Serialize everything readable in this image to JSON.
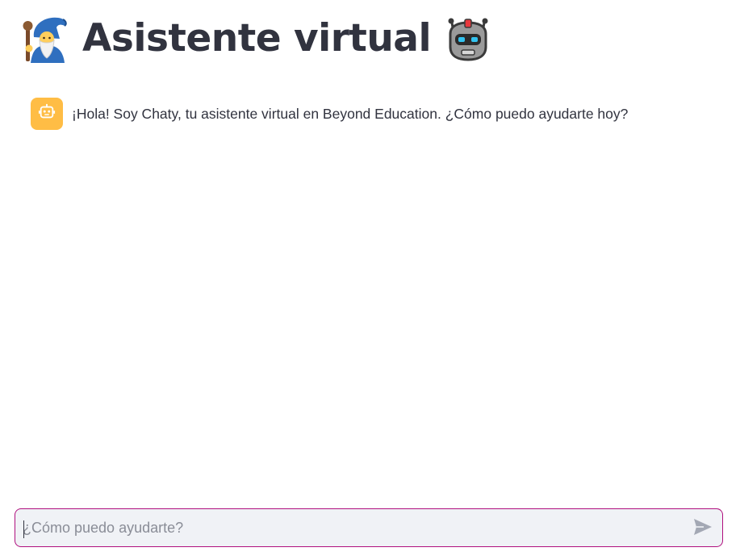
{
  "header": {
    "title": "Asistente virtual",
    "left_icon": "mage-icon",
    "right_icon": "robot-icon"
  },
  "chat": {
    "messages": [
      {
        "role": "assistant",
        "avatar_icon": "robot-icon",
        "avatar_color": "#ffbd45",
        "text": "¡Hola! Soy Chaty, tu asistente virtual en Beyond Education. ¿Cómo puedo ayudarte hoy?"
      }
    ]
  },
  "chat_input": {
    "placeholder": "¿Cómo puedo ayudarte?",
    "value": "",
    "send_icon": "send-icon",
    "border_color": "#b0107e"
  }
}
